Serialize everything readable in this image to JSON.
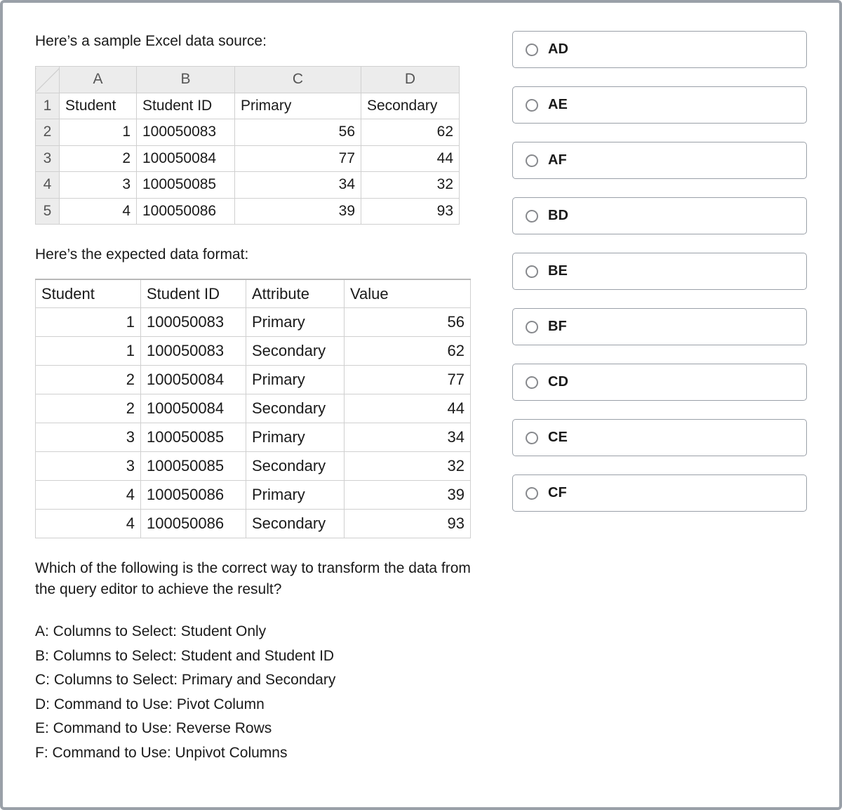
{
  "intro1": "Here’s a sample Excel data source:",
  "intro2": "Here’s the expected data format:",
  "excel_source": {
    "col_letters": [
      "A",
      "B",
      "C",
      "D"
    ],
    "headers": [
      "Student",
      "Student ID",
      "Primary",
      "Secondary"
    ],
    "rows": [
      {
        "rn": "1"
      },
      {
        "rn": "2",
        "student": "1",
        "id": "100050083",
        "primary": "56",
        "secondary": "62"
      },
      {
        "rn": "3",
        "student": "2",
        "id": "100050084",
        "primary": "77",
        "secondary": "44"
      },
      {
        "rn": "4",
        "student": "3",
        "id": "100050085",
        "primary": "34",
        "secondary": "32"
      },
      {
        "rn": "5",
        "student": "4",
        "id": "100050086",
        "primary": "39",
        "secondary": "93"
      }
    ]
  },
  "expected": {
    "headers": [
      "Student",
      "Student ID",
      "Attribute",
      "Value"
    ],
    "rows": [
      {
        "student": "1",
        "id": "100050083",
        "attr": "Primary",
        "val": "56"
      },
      {
        "student": "1",
        "id": "100050083",
        "attr": "Secondary",
        "val": "62"
      },
      {
        "student": "2",
        "id": "100050084",
        "attr": "Primary",
        "val": "77"
      },
      {
        "student": "2",
        "id": "100050084",
        "attr": "Secondary",
        "val": "44"
      },
      {
        "student": "3",
        "id": "100050085",
        "attr": "Primary",
        "val": "34"
      },
      {
        "student": "3",
        "id": "100050085",
        "attr": "Secondary",
        "val": "32"
      },
      {
        "student": "4",
        "id": "100050086",
        "attr": "Primary",
        "val": "39"
      },
      {
        "student": "4",
        "id": "100050086",
        "attr": "Secondary",
        "val": "93"
      }
    ]
  },
  "question": "Which of the following is the correct way to transform the data from the query editor to achieve the result?",
  "choice_defs": {
    "A": "A: Columns to Select: Student Only",
    "B": "B: Columns to Select: Student and Student ID",
    "C": "C: Columns to Select: Primary and Secondary",
    "D": "D: Command to Use: Pivot Column",
    "E": "E: Command to Use: Reverse Rows",
    "F": "F: Command to Use: Unpivot Columns"
  },
  "answers": [
    "AD",
    "AE",
    "AF",
    "BD",
    "BE",
    "BF",
    "CD",
    "CE",
    "CF"
  ]
}
